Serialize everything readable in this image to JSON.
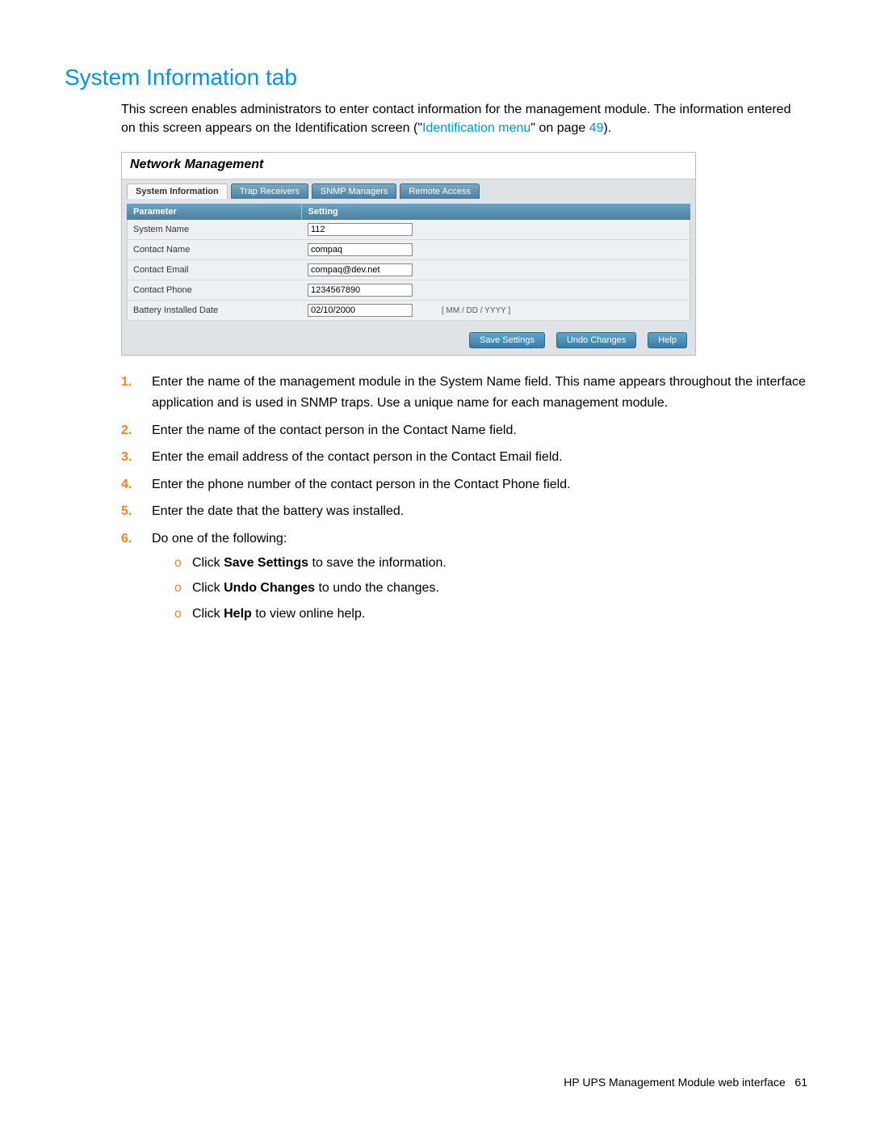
{
  "heading": "System Information tab",
  "intro_part1": "This screen enables administrators to enter contact information for the management module. The information entered on this screen appears on the Identification screen (\"",
  "intro_link": "Identification menu",
  "intro_part2": "\" on page ",
  "intro_page_ref": "49",
  "intro_part3": ").",
  "screenshot": {
    "title": "Network Management",
    "tabs": [
      "System Information",
      "Trap Receivers",
      "SNMP Managers",
      "Remote Access"
    ],
    "header_param": "Parameter",
    "header_setting": "Setting",
    "rows": [
      {
        "param": "System Name",
        "value": "112",
        "hint": ""
      },
      {
        "param": "Contact Name",
        "value": "compaq",
        "hint": ""
      },
      {
        "param": "Contact Email",
        "value": "compaq@dev.net",
        "hint": ""
      },
      {
        "param": "Contact Phone",
        "value": "1234567890",
        "hint": ""
      },
      {
        "param": "Battery Installed Date",
        "value": "02/10/2000",
        "hint": "[ MM / DD / YYYY ]"
      }
    ],
    "buttons": {
      "save": "Save Settings",
      "undo": "Undo Changes",
      "help": "Help"
    }
  },
  "steps": {
    "s1": "Enter the name of the management module in the System Name field. This name appears throughout the interface application and is used in SNMP traps. Use a unique name for each management module.",
    "s2": "Enter the name of the contact person in the Contact Name field.",
    "s3": "Enter the email address of the contact person in the Contact Email field.",
    "s4": "Enter the phone number of the contact person in the Contact Phone field.",
    "s5": "Enter the date that the battery was installed.",
    "s6": "Do one of the following:",
    "s6a_pre": "Click ",
    "s6a_b": "Save Settings",
    "s6a_post": " to save the information.",
    "s6b_pre": "Click ",
    "s6b_b": "Undo Changes",
    "s6b_post": " to undo the changes.",
    "s6c_pre": "Click ",
    "s6c_b": "Help",
    "s6c_post": " to view online help."
  },
  "footer_text": "HP UPS Management Module web interface",
  "footer_page": "61"
}
